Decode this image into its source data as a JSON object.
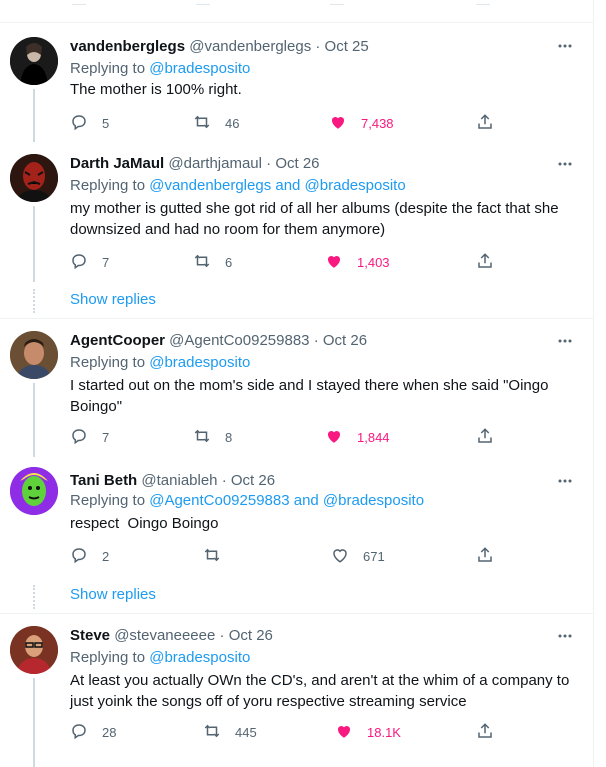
{
  "tweets": [
    {
      "name": "vandenberglegs",
      "handle": "@vandenberglegs",
      "date": "Oct 25",
      "replying_label": "Replying to",
      "replying_to": "@bradesposito",
      "text": "The mother is 100% right.",
      "replies": "5",
      "retweets": "46",
      "likes": "7,438",
      "liked": true
    },
    {
      "name": "Darth JaMaul",
      "handle": "@darthjamaul",
      "date": "Oct 26",
      "replying_label": "Replying to",
      "replying_to": "@vandenberglegs and @bradesposito",
      "text": "my mother is gutted she got rid of all her albums (despite the fact that she downsized and had no room for them anymore)",
      "replies": "7",
      "retweets": "6",
      "likes": "1,403",
      "liked": true
    },
    {
      "name": "AgentCooper",
      "handle": "@AgentCo09259883",
      "date": "Oct 26",
      "replying_label": "Replying to",
      "replying_to": "@bradesposito",
      "text": "I started out on the mom's side and I stayed there when she said \"Oingo Boingo\"",
      "replies": "7",
      "retweets": "8",
      "likes": "1,844",
      "liked": true
    },
    {
      "name": "Tani Beth",
      "handle": "@taniableh",
      "date": "Oct 26",
      "replying_label": "Replying to",
      "replying_to": "@AgentCo09259883 and @bradesposito",
      "text": "respect  Oingo Boingo",
      "replies": "2",
      "retweets": "",
      "likes": "671",
      "liked": false
    },
    {
      "name": "Steve",
      "handle": "@stevaneeeee",
      "date": "Oct 26",
      "replying_label": "Replying to",
      "replying_to": "@bradesposito",
      "text": "At least you actually OWn the CD's, and aren't at the whim of a company to just yoink the songs off of yoru respective streaming service",
      "replies": "28",
      "retweets": "445",
      "likes": "18.1K",
      "liked": true
    }
  ],
  "show_replies": "Show replies",
  "sep_dot": "·",
  "colors": {
    "like": "#f91880",
    "link": "#1d9bf0",
    "muted": "#536471"
  },
  "icons": {
    "reply": "reply-icon",
    "retweet": "retweet-icon",
    "like": "heart-icon",
    "share": "share-icon",
    "more": "more-icon"
  }
}
